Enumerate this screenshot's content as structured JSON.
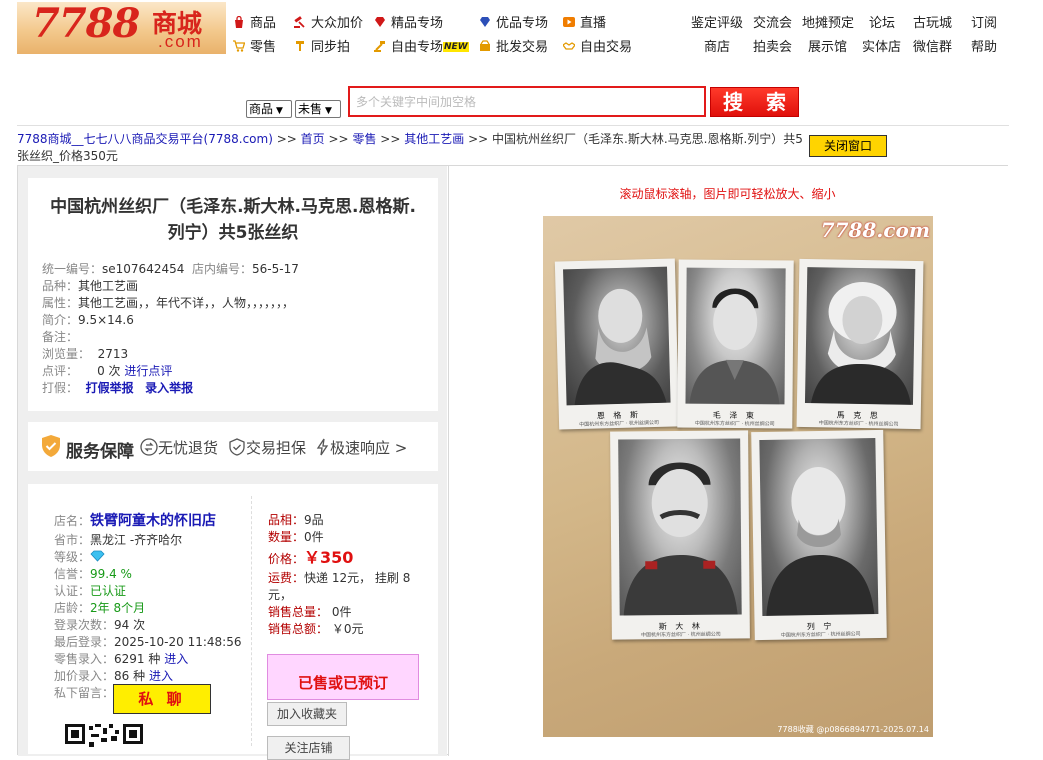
{
  "logo": {
    "num": "7788",
    "cn": "商城",
    "com": ".com"
  },
  "nav": {
    "row1": [
      "商品",
      "大众加价",
      "精品专场",
      "优品专场",
      "直播"
    ],
    "row2": [
      "零售",
      "同步拍",
      "自由专场",
      "批发交易",
      "自由交易"
    ],
    "new_tag": "NEW",
    "right1": [
      "鉴定评级",
      "交流会",
      "地摊预定",
      "论坛",
      "古玩城",
      "订阅"
    ],
    "right2": [
      "商店",
      "拍卖会",
      "展示馆",
      "实体店",
      "微信群",
      "帮助"
    ]
  },
  "search": {
    "type_select": "商品",
    "status_select": "未售",
    "placeholder": "多个关键字中间加空格",
    "button": "搜 索"
  },
  "breadcrumb": {
    "site": "7788商城__七七八八商品交易平台(7788.com)",
    "sep": ">>",
    "home": "首页",
    "retail": "零售",
    "category": "其他工艺画",
    "current": "中国杭州丝织厂（毛泽东.斯大林.马克思.恩格斯.列宁）共5张丝织_价格350元"
  },
  "close_button": "关闭窗口",
  "item": {
    "title": "中国杭州丝织厂（毛泽东.斯大林.马克思.恩格斯.列宁）共5张丝织",
    "id_label": "统一编号：",
    "id": "se107642454",
    "store_id_label": "店内编号：",
    "store_id": "56-5-17",
    "category_label": "品种：",
    "category": "其他工艺画",
    "attr_label": "属性：",
    "attr": "其他工艺画，，年代不详，，人物，，，，，，，",
    "intro_label": "简介：",
    "intro": "9.5×14.6",
    "note_label": "备注：",
    "views_label": "浏览量：",
    "views": "2713",
    "comments_label": "点评：",
    "comments": "0 次",
    "comment_link": "进行点评",
    "fake_label": "打假：",
    "fake_link1": "打假举报",
    "fake_link2": "录入举报"
  },
  "service": {
    "title": "服务保障",
    "items": [
      "无忧退货",
      "交易担保",
      "极速响应 >"
    ]
  },
  "shop": {
    "name_label": "店名：",
    "name": "铁臂阿童木的怀旧店",
    "loc_label": "省市：",
    "loc": "黑龙江 -齐齐哈尔",
    "level_label": "等级：",
    "credit_label": "信誉：",
    "credit": "99.4 %",
    "verify_label": "认证：",
    "verify": "已认证",
    "age_label": "店龄：",
    "age": "2年 8个月",
    "logins_label": "登录次数：",
    "logins": "94 次",
    "last_login_label": "最后登录：",
    "last_login": "2025-10-20 11:48:56",
    "retail_label": "零售录入：",
    "retail": "6291 种",
    "retail_link": "进入",
    "markup_label": "加价录入：",
    "markup": "86 种",
    "markup_link": "进入",
    "msg_label": "私下留言：",
    "chat_button": "私 聊"
  },
  "deal": {
    "cond_label": "品相：",
    "cond": "9品",
    "qty_label": "数量：",
    "qty": "0件",
    "price_label": "价格：",
    "price": "￥350",
    "ship_label": "运费：",
    "ship": "快递 12元， 挂刷 8元，",
    "sold_count_label": "销售总量：",
    "sold_count": "0件",
    "sold_amount_label": "销售总额：",
    "sold_amount": "￥0元",
    "sold_box": "已售或已预订",
    "fav_button": "加入收藏夹",
    "follow_button": "关注店铺"
  },
  "image": {
    "hint": "滚动鼠标滚轴，图片即可轻松放大、缩小",
    "watermark": "7788.com",
    "watermark2": "7788收藏 @p0866894771-2025.07.14",
    "captions": [
      "恩 格 斯",
      "毛 泽 東",
      "馬 克 思",
      "斯 大 林",
      "列 宁"
    ],
    "subcaption": "中国杭州东方丝织厂 · 杭州丝绸公司"
  }
}
